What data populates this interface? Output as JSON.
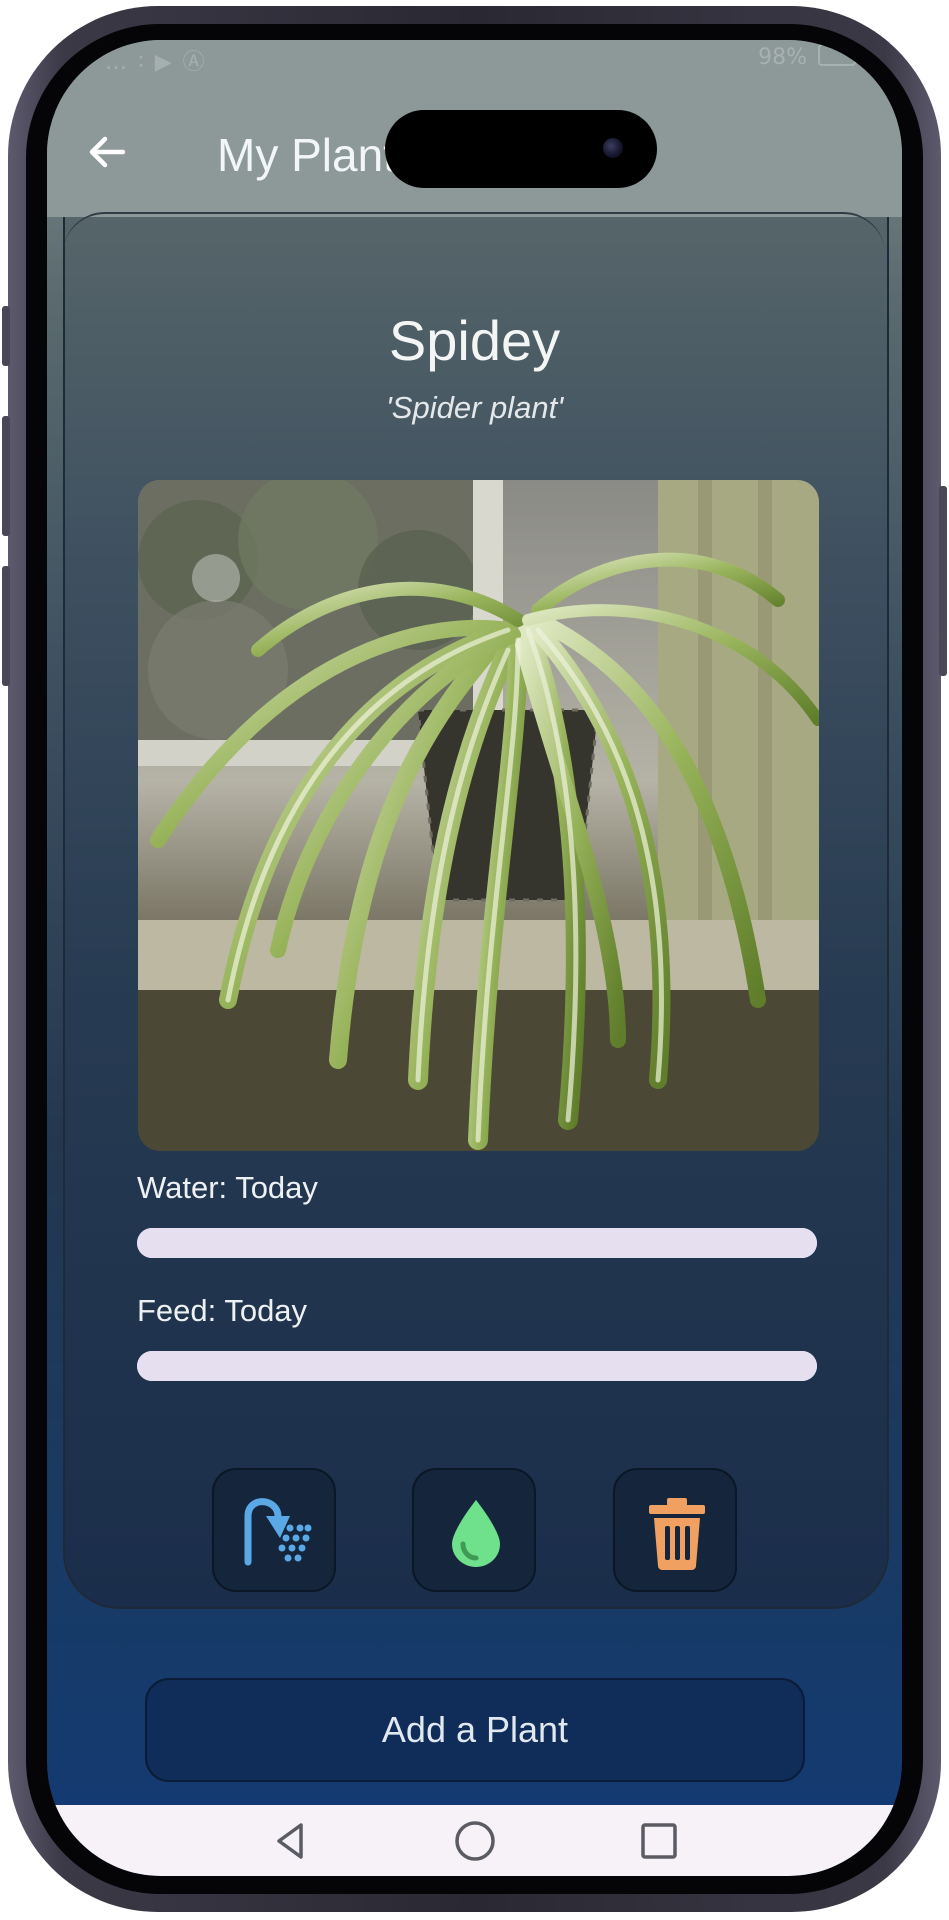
{
  "status_bar": {
    "left_icons": "… ∶ ▶ Ⓐ",
    "battery": "98%"
  },
  "appbar": {
    "title": "My Plants",
    "back_icon": "arrow-left-icon"
  },
  "plant": {
    "name": "Spidey",
    "species": "'Spider plant'",
    "photo_subject": "spider-plant-photo",
    "water_label": "Water: Today",
    "water_level": 1.0,
    "feed_label": "Feed: Today",
    "feed_level": 1.0,
    "actions": [
      {
        "name": "water-button",
        "icon": "shower-icon",
        "color": "#5aa9e6"
      },
      {
        "name": "feed-button",
        "icon": "droplet-icon",
        "color": "#6fe08c"
      },
      {
        "name": "delete-button",
        "icon": "trash-icon",
        "color": "#f0a060"
      }
    ]
  },
  "add_button": {
    "label": "Add a Plant"
  },
  "nav": {
    "back": "triangle-back-icon",
    "home": "circle-home-icon",
    "recents": "square-recents-icon"
  },
  "colors": {
    "appbar": "#8c9998",
    "progress": "#e6dff0",
    "button_bg": "#15263c",
    "add_button_bg": "#0f2d58"
  }
}
